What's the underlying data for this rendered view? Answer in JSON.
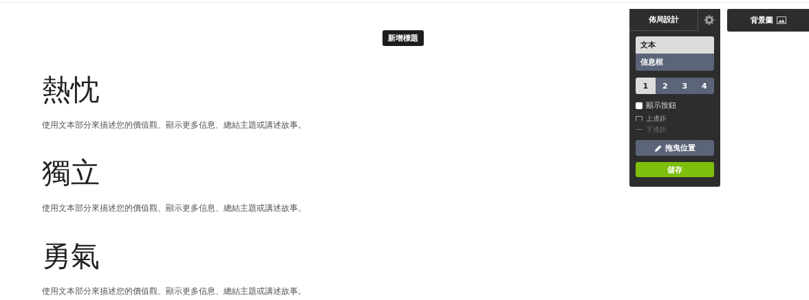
{
  "tooltip": "新增標題",
  "sections": [
    {
      "title": "熱忱",
      "text": "使用文本部分來描述您的價值觀、顯示更多信息、總結主題或講述故事。"
    },
    {
      "title": "獨立",
      "text": "使用文本部分來描述您的價值觀、顯示更多信息、總結主題或講述故事。"
    },
    {
      "title": "勇氣",
      "text": "使用文本部分來描述您的價值觀、顯示更多信息、總結主題或講述故事。"
    }
  ],
  "panel": {
    "tab": "佈局設計",
    "layouts": [
      {
        "label": "文本",
        "selected": true
      },
      {
        "label": "信息框",
        "selected": false
      }
    ],
    "columns": [
      {
        "label": "1",
        "selected": true
      },
      {
        "label": "2",
        "selected": false
      },
      {
        "label": "3",
        "selected": false
      },
      {
        "label": "4",
        "selected": false
      }
    ],
    "show_button": {
      "label": "顯示按鈕",
      "checked": false
    },
    "margins": [
      {
        "label": "上邊距",
        "disabled": false
      },
      {
        "label": "下邊距",
        "disabled": true
      }
    ],
    "drag_button": "拖曳位置",
    "save_button": "儲存"
  },
  "background_button": "背景圖"
}
